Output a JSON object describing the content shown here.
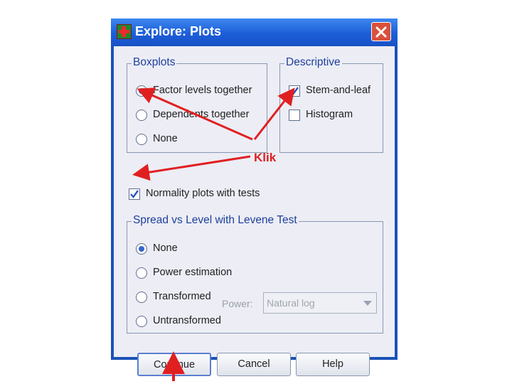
{
  "window": {
    "title": "Explore: Plots",
    "icons": {
      "app": "spss-dialog-icon",
      "close": "close-icon"
    }
  },
  "boxplots": {
    "legend": "Boxplots",
    "options": [
      {
        "label": "Factor levels together",
        "selected": true
      },
      {
        "label": "Dependents together",
        "selected": false
      },
      {
        "label": "None",
        "selected": false
      }
    ]
  },
  "descriptive": {
    "legend": "Descriptive",
    "options": [
      {
        "label": "Stem-and-leaf",
        "checked": true
      },
      {
        "label": "Histogram",
        "checked": false
      }
    ]
  },
  "normality": {
    "label": "Normality plots with tests",
    "checked": true
  },
  "spread": {
    "legend": "Spread vs Level with Levene Test",
    "options": [
      {
        "label": "None",
        "selected": true
      },
      {
        "label": "Power estimation",
        "selected": false
      },
      {
        "label": "Transformed",
        "selected": false
      },
      {
        "label": "Untransformed",
        "selected": false
      }
    ],
    "power_label": "Power:",
    "power_value": "Natural log"
  },
  "buttons": {
    "continue": "Continue",
    "cancel": "Cancel",
    "help": "Help"
  },
  "annotation": {
    "text": "Klik",
    "color": "#e02020"
  }
}
